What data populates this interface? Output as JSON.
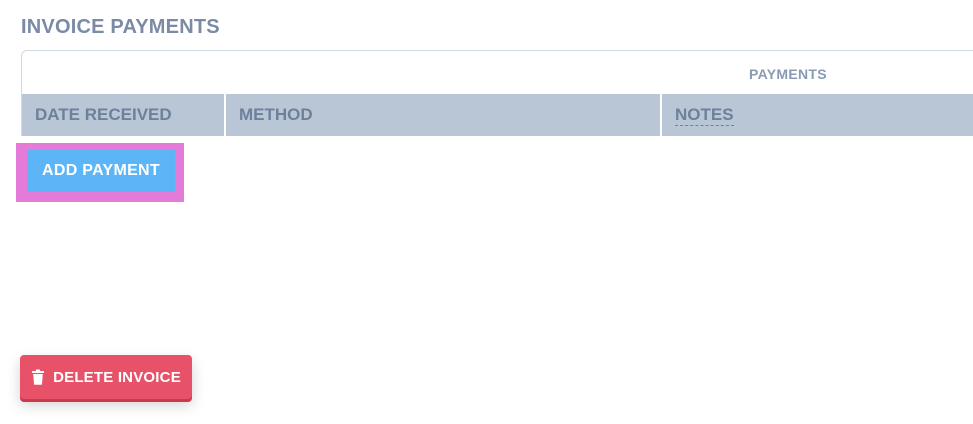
{
  "section": {
    "title": "INVOICE PAYMENTS"
  },
  "payments_table": {
    "caption": "PAYMENTS",
    "columns": [
      "DATE RECEIVED",
      "METHOD",
      "NOTES"
    ],
    "rows": []
  },
  "actions": {
    "add_payment_label": "ADD PAYMENT",
    "delete_invoice_label": "DELETE INVOICE",
    "delete_icon": "trash-icon"
  },
  "colors": {
    "add_button": "#5bb5f7",
    "highlight": "#e57bd8",
    "delete_button": "#e85268",
    "header_bg": "#b8c6d6"
  }
}
